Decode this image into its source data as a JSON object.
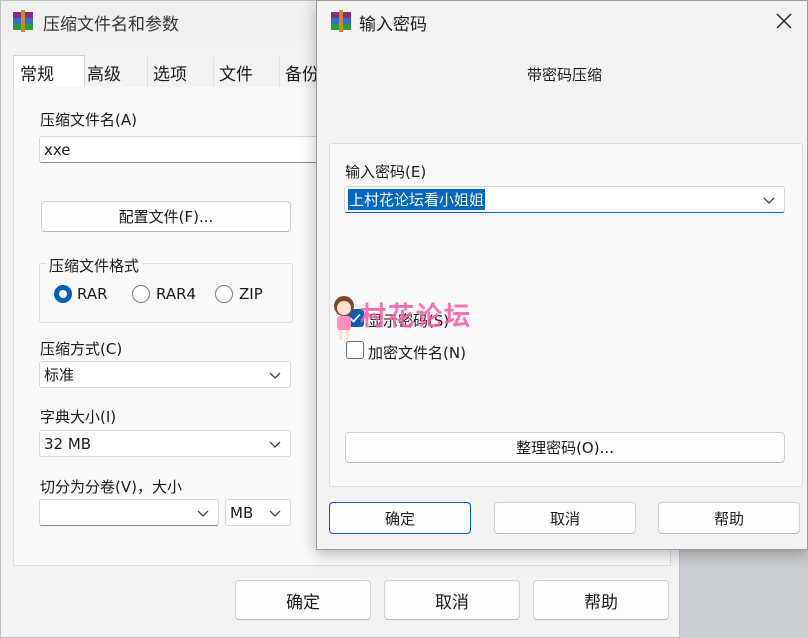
{
  "main_window": {
    "title": "压缩文件名和参数",
    "tabs": [
      "常规",
      "高级",
      "选项",
      "文件",
      "备份"
    ],
    "archive_name_label": "压缩文件名(A)",
    "archive_name_value": "xxe",
    "profiles_button": "配置文件(F)...",
    "format_group_label": "压缩文件格式",
    "format_options": [
      "RAR",
      "RAR4",
      "ZIP"
    ],
    "method_label": "压缩方式(C)",
    "method_value": "标准",
    "dict_label": "字典大小(I)",
    "dict_value": "32 MB",
    "split_label": "切分为分卷(V)，大小",
    "split_value": "",
    "split_unit": "MB",
    "ok": "确定",
    "cancel": "取消",
    "help": "帮助"
  },
  "dialog": {
    "title": "输入密码",
    "subtitle": "带密码压缩",
    "password_label": "输入密码(E)",
    "password_value": "上村花论坛看小姐姐",
    "show_password": "显示密码(S)",
    "encrypt_names": "加密文件名(N)",
    "organize_button": "整理密码(O)...",
    "ok": "确定",
    "cancel": "取消",
    "help": "帮助"
  },
  "watermark": {
    "text": "村花论坛"
  },
  "colors": {
    "accent": "#005fb8",
    "watermark": "#ff5aa5"
  }
}
